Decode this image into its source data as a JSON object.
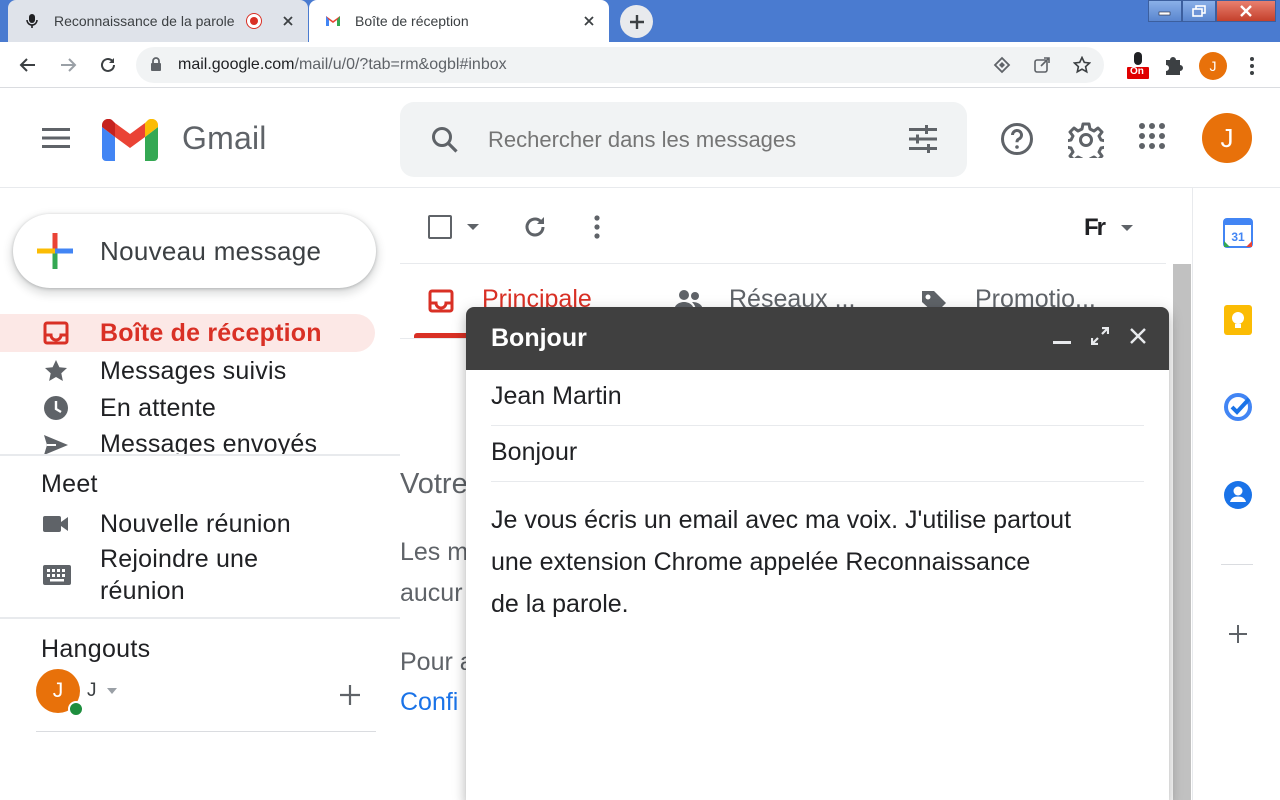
{
  "browser": {
    "tabs": [
      {
        "title": "Reconnaissance de la parole",
        "active": false
      },
      {
        "title": "Boîte de réception",
        "active": true
      }
    ],
    "url_host": "mail.google.com",
    "url_path": "/mail/u/0/?tab=rm&ogbl#inbox",
    "ext_badge": "On",
    "profile_initial": "J"
  },
  "gmail": {
    "logo_text": "Gmail",
    "search_placeholder": "Rechercher dans les messages",
    "avatar_initial": "J"
  },
  "nav": {
    "compose_label": "Nouveau message",
    "items": [
      {
        "label": "Boîte de réception",
        "active": true
      },
      {
        "label": "Messages suivis"
      },
      {
        "label": "En attente"
      },
      {
        "label": "Messages envoyés"
      }
    ],
    "meet": {
      "title": "Meet",
      "new_meeting": "Nouvelle réunion",
      "join_line1": "Rejoindre une",
      "join_line2": "réunion"
    },
    "hangouts": {
      "title": "Hangouts",
      "user_initial": "J",
      "user_name": "J"
    }
  },
  "main": {
    "lang_label": "Fr",
    "category_tabs": [
      {
        "label": "Principale",
        "active": true
      },
      {
        "label": "Réseaux ..."
      },
      {
        "label": "Promotio..."
      }
    ],
    "empty_heading": "Votre",
    "empty_line1": "Les m",
    "empty_line2": "aucur",
    "empty_line3": "Pour a",
    "empty_link": "Confi"
  },
  "compose_window": {
    "title": "Bonjour",
    "to": "Jean Martin",
    "subject": "Bonjour",
    "body_line1": "Je vous écris un email avec ma voix. J'utilise partout",
    "body_line2": "une extension Chrome appelée Reconnaissance",
    "body_line3": "de la parole."
  },
  "side_panel": {
    "calendar_day": "31"
  },
  "colors": {
    "accent_red": "#d93025",
    "avatar_orange": "#e8710a",
    "link_blue": "#1a73e8",
    "compose_header": "#404040"
  }
}
